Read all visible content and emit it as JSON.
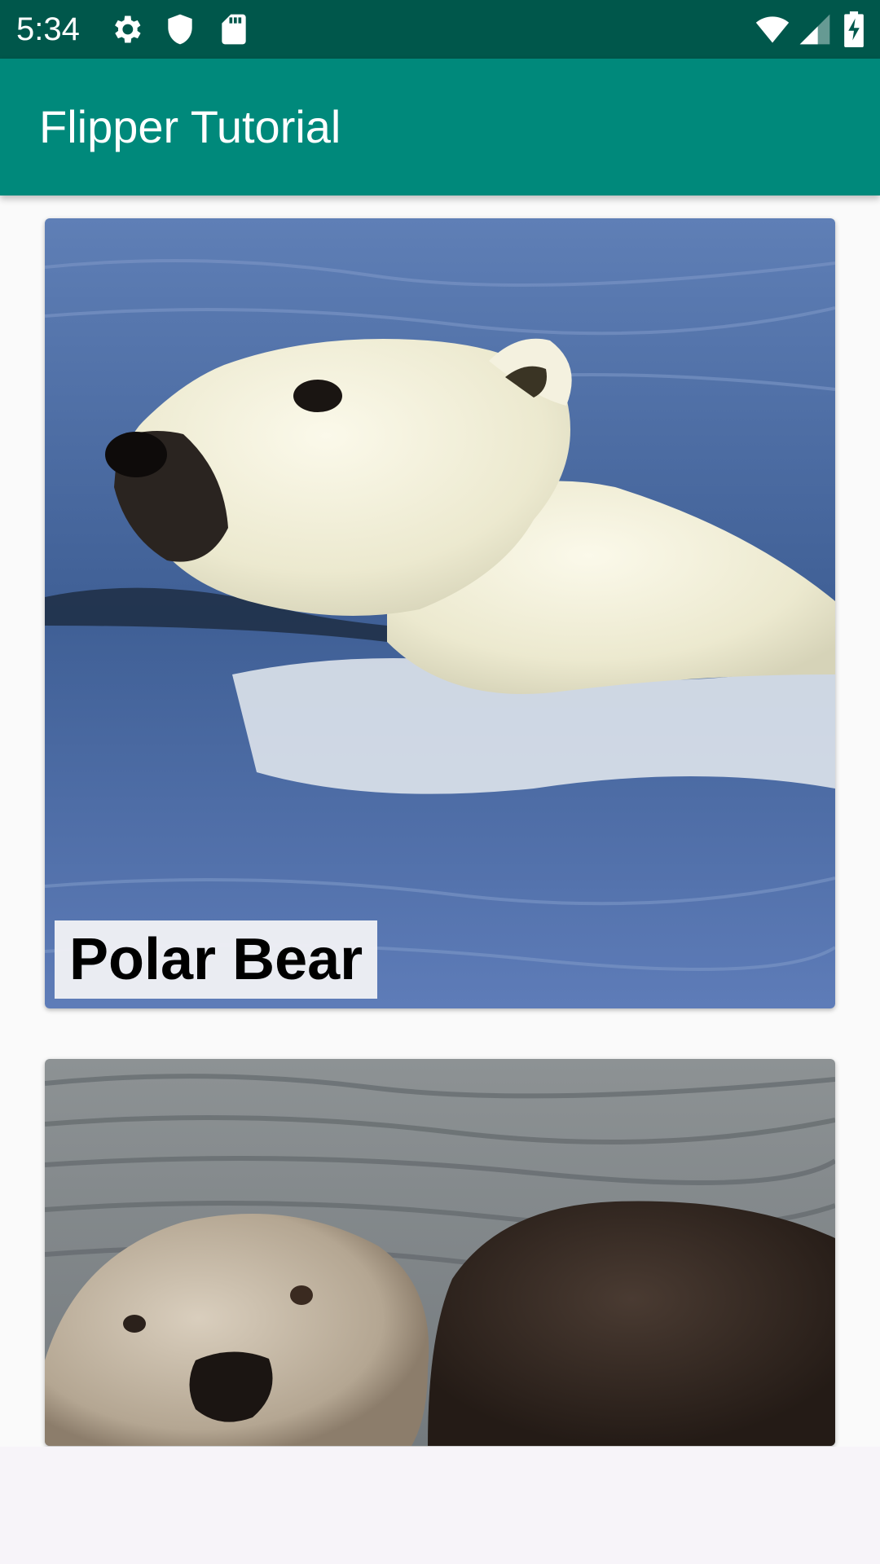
{
  "status_bar": {
    "time": "5:34",
    "left_icons": [
      "gear-icon",
      "shield-icon",
      "sd-card-icon"
    ],
    "right_icons": [
      "wifi-icon",
      "cell-signal-icon",
      "battery-charging-icon"
    ],
    "background": "#00574b"
  },
  "app_bar": {
    "title": "Flipper Tutorial",
    "background": "#00897b"
  },
  "cards": [
    {
      "caption": "Polar Bear",
      "image": "polar-bear-photo"
    },
    {
      "caption": "",
      "image": "sea-otter-photo"
    }
  ]
}
